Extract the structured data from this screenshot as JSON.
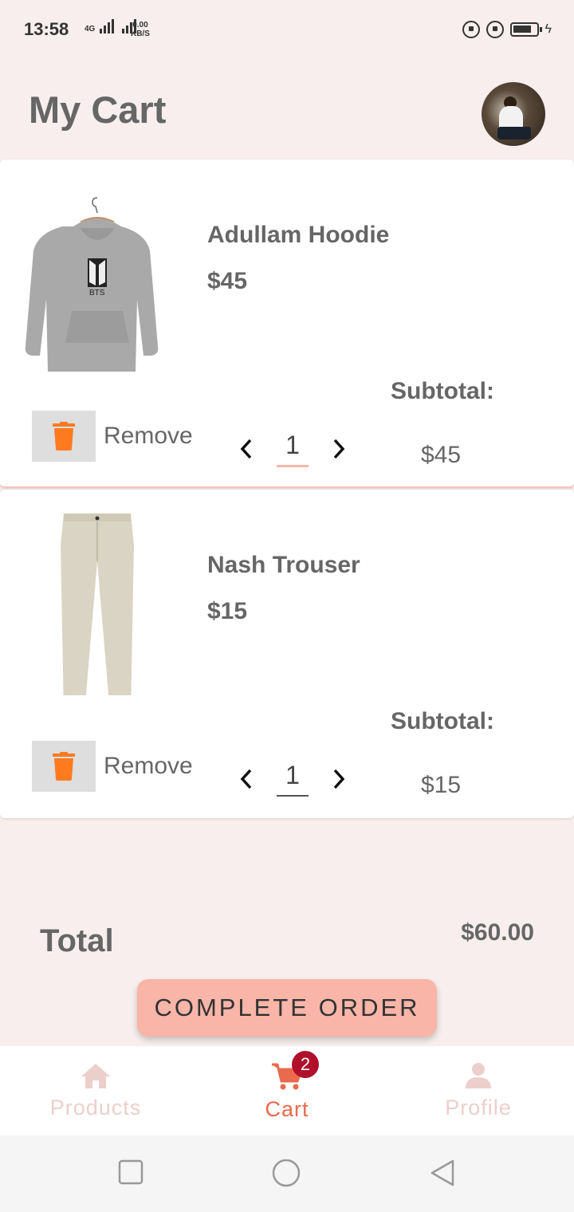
{
  "status_bar": {
    "time": "13:58",
    "network_type": "4G",
    "speed_value": "0.00",
    "speed_unit": "KB/S"
  },
  "header": {
    "title": "My Cart"
  },
  "cart_items": [
    {
      "name": "Adullam Hoodie",
      "price": "$45",
      "subtotal_label": "Subtotal:",
      "subtotal": "$45",
      "quantity": "1",
      "remove_label": "Remove"
    },
    {
      "name": "Nash Trouser",
      "price": "$15",
      "subtotal_label": "Subtotal:",
      "subtotal": "$15",
      "quantity": "1",
      "remove_label": "Remove"
    }
  ],
  "summary": {
    "total_label": "Total",
    "total_value": "$60.00",
    "complete_button": "COMPLETE ORDER"
  },
  "bottom_nav": {
    "items": [
      {
        "label": "Products",
        "icon": "home-icon"
      },
      {
        "label": "Cart",
        "icon": "cart-icon",
        "active": true
      },
      {
        "label": "Profile",
        "icon": "person-icon"
      }
    ],
    "cart_badge": "2"
  },
  "colors": {
    "background": "#f7eeed",
    "accent": "#e96a4c",
    "button": "#f8b5a8",
    "trash": "#fd7a1f",
    "badge": "#b0102a"
  }
}
